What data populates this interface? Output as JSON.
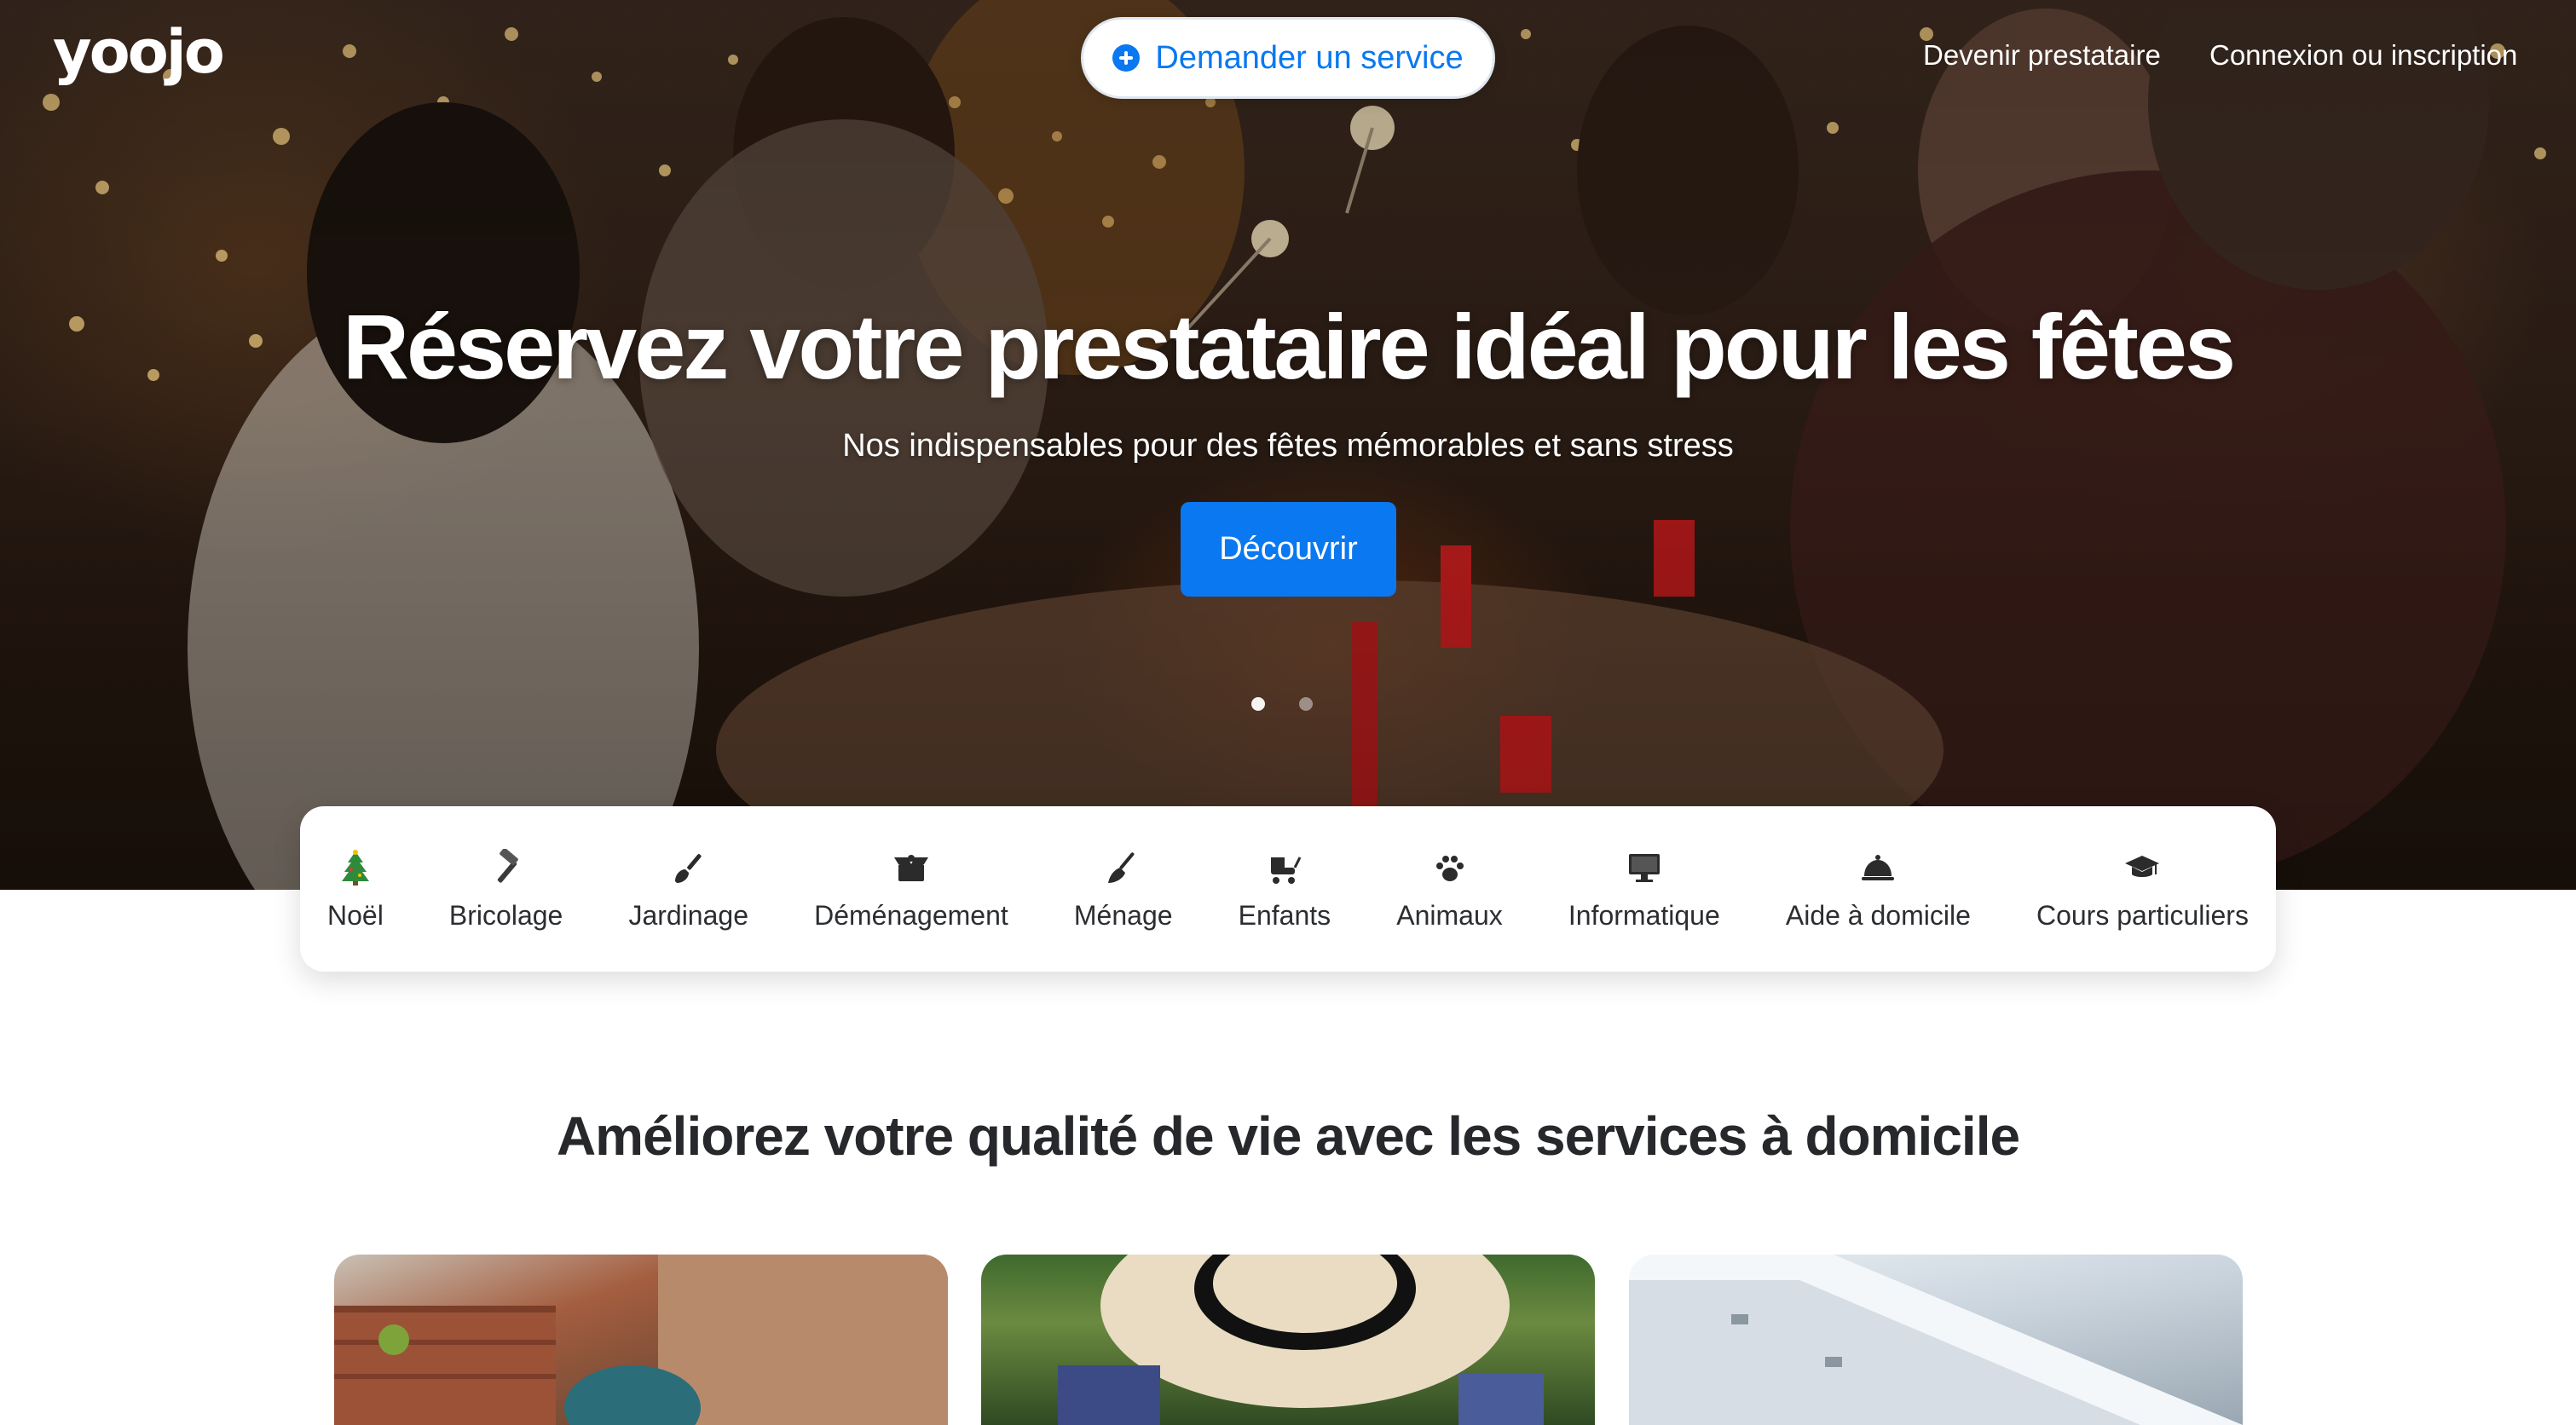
{
  "header": {
    "logo_text": "yoojo",
    "request_button_label": "Demander un service",
    "become_provider_label": "Devenir prestataire",
    "login_label": "Connexion ou inscription"
  },
  "hero": {
    "title": "Réservez votre prestataire idéal pour les fêtes",
    "subtitle": "Nos indispensables pour des fêtes mémorables et sans stress",
    "cta_label": "Découvrir",
    "slides_count": 2,
    "active_slide": 1
  },
  "categories": [
    {
      "label": "Noël",
      "icon": "christmas-tree-icon"
    },
    {
      "label": "Bricolage",
      "icon": "hammer-icon"
    },
    {
      "label": "Jardinage",
      "icon": "shovel-icon"
    },
    {
      "label": "Déménagement",
      "icon": "moving-box-icon"
    },
    {
      "label": "Ménage",
      "icon": "broom-icon"
    },
    {
      "label": "Enfants",
      "icon": "baby-stroller-icon"
    },
    {
      "label": "Animaux",
      "icon": "paw-icon"
    },
    {
      "label": "Informatique",
      "icon": "monitor-icon"
    },
    {
      "label": "Aide à domicile",
      "icon": "cloche-icon"
    },
    {
      "label": "Cours particuliers",
      "icon": "graduation-cap-icon"
    }
  ],
  "section": {
    "title": "Améliorez votre qualité de vie avec les services à domicile"
  },
  "colors": {
    "brand_blue": "#0a78f0",
    "hero_overlay": "#2e1f16",
    "text_dark": "#26282c",
    "christmas_green": "#2e8b3a"
  }
}
